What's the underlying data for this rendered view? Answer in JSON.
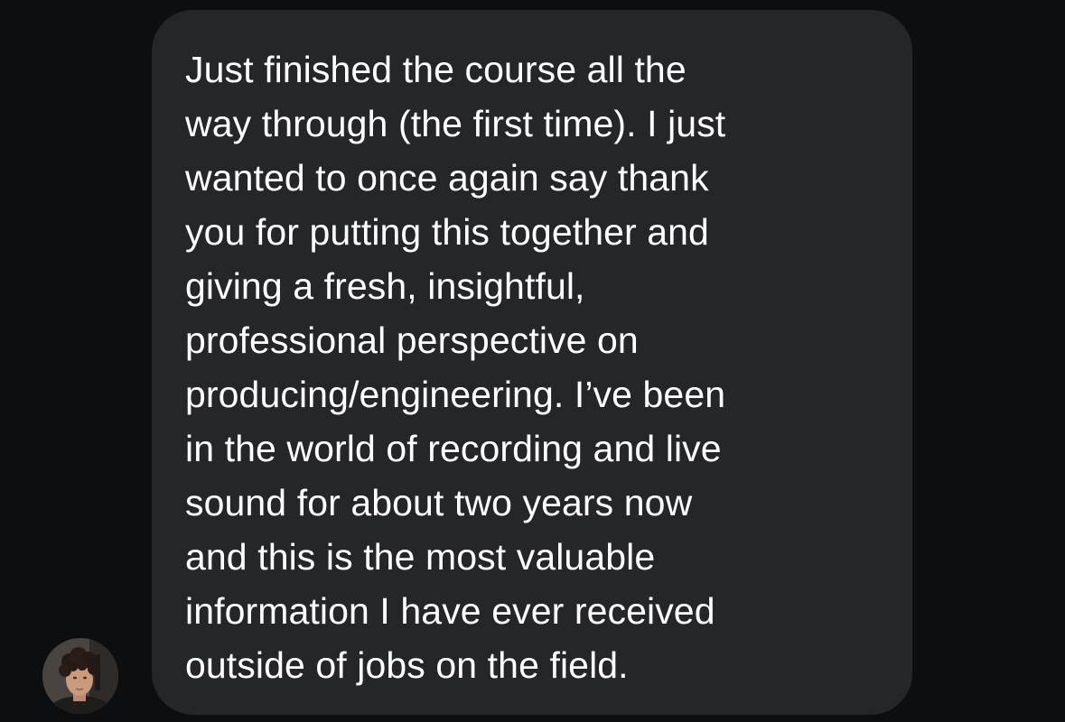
{
  "conversation": {
    "sender_avatar_icon": "profile-photo",
    "message_lines": [
      "Just finished the course all the",
      "way through (the first time). I just",
      "wanted to once again say thank",
      "you for putting this together and",
      "giving a fresh, insightful,",
      "professional perspective on",
      "producing/engineering. I’ve been",
      "in the world of recording and live",
      "sound for about two years now",
      "and this is the most valuable",
      "information I have ever received",
      "outside of jobs on the field."
    ],
    "colors": {
      "background": "#0d0e10",
      "bubble": "#25262a",
      "text": "#ffffff"
    }
  }
}
